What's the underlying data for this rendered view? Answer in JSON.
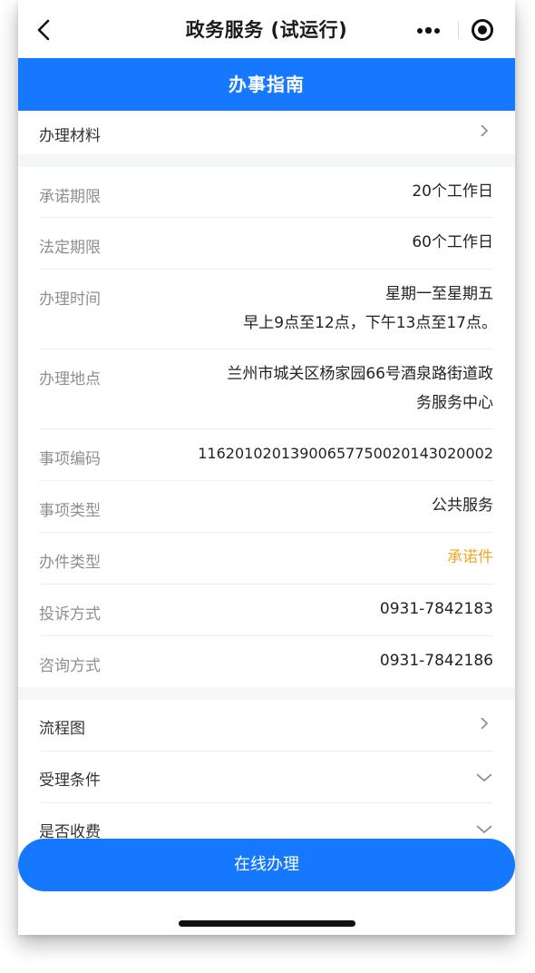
{
  "navbar": {
    "title": "政务服务 (试运行)",
    "back_icon": "chevron-left-icon",
    "more_icon": "more-dots-icon",
    "close_icon": "target-close-icon"
  },
  "banner": {
    "title": "办事指南"
  },
  "materials": {
    "label": "办理材料",
    "icon": "chevron-right-icon"
  },
  "info": [
    {
      "key": "承诺期限",
      "value": "20个工作日"
    },
    {
      "key": "法定期限",
      "value": "60个工作日"
    },
    {
      "key": "办理时间",
      "value_line1": "星期一至星期五",
      "value_line2": "早上9点至12点，下午13点至17点。"
    },
    {
      "key": "办理地点",
      "value_line1": "兰州市城关区杨家园66号酒泉路街道政",
      "value_line2": "务服务中心"
    },
    {
      "key": "事项编码",
      "value": "11620102013900657750020143020002"
    },
    {
      "key": "事项类型",
      "value": "公共服务"
    },
    {
      "key": "办件类型",
      "value": "承诺件"
    },
    {
      "key": "投诉方式",
      "value": "0931-7842183"
    },
    {
      "key": "咨询方式",
      "value": "0931-7842186"
    }
  ],
  "sections": [
    {
      "label": "流程图",
      "icon": "chevron-right-icon"
    },
    {
      "label": "受理条件",
      "icon": "chevron-down-icon"
    },
    {
      "label": "是否收费",
      "icon": "chevron-down-icon"
    }
  ],
  "cta": {
    "label": "在线办理"
  },
  "colors": {
    "primary": "#1677ff",
    "accent_orange": "#f5a623"
  }
}
